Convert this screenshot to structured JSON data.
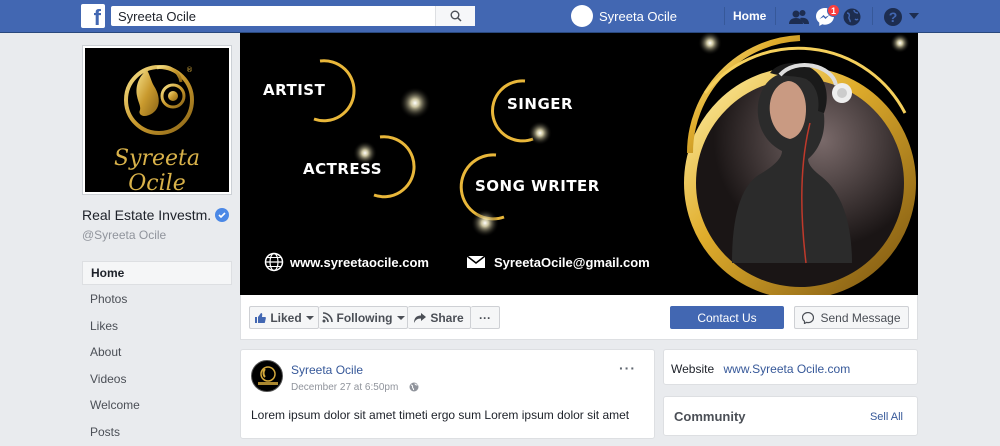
{
  "topbar": {
    "search_value": "Syreeta Ocile",
    "profile_name": "Syreeta Ocile",
    "home_label": "Home",
    "messages_badge": "1"
  },
  "page": {
    "name": "Real Estate Investm.",
    "handle": "@Syreeta Ocile",
    "logo_text": "Syreeta Ocile"
  },
  "left_nav": [
    "Home",
    "Photos",
    "Likes",
    "About",
    "Videos",
    "Welcome",
    "Posts"
  ],
  "cover": {
    "words": [
      "ARTIST",
      "SINGER",
      "ACTRESS",
      "SONG WRITER"
    ],
    "website": "www.syreetaocile.com",
    "email": "SyreetaOcile@gmail.com"
  },
  "actions": {
    "liked": "Liked",
    "following": "Following",
    "share": "Share",
    "more": "···",
    "contact": "Contact Us",
    "send_message": "Send Message"
  },
  "post": {
    "author": "Syreeta Ocile",
    "date": "December 27 at 6:50pm",
    "more": "···",
    "text": "Lorem ipsum dolor sit amet timeti ergo sum Lorem ipsum dolor sit amet"
  },
  "about": {
    "website_label": "Website",
    "website_value": "www.Syreeta Ocile.com"
  },
  "community": {
    "title": "Community",
    "see_all": "Sell All"
  },
  "colors": {
    "brand": "#4267b2",
    "gold": "#d4a93c",
    "badge": "#fa3e3e"
  }
}
